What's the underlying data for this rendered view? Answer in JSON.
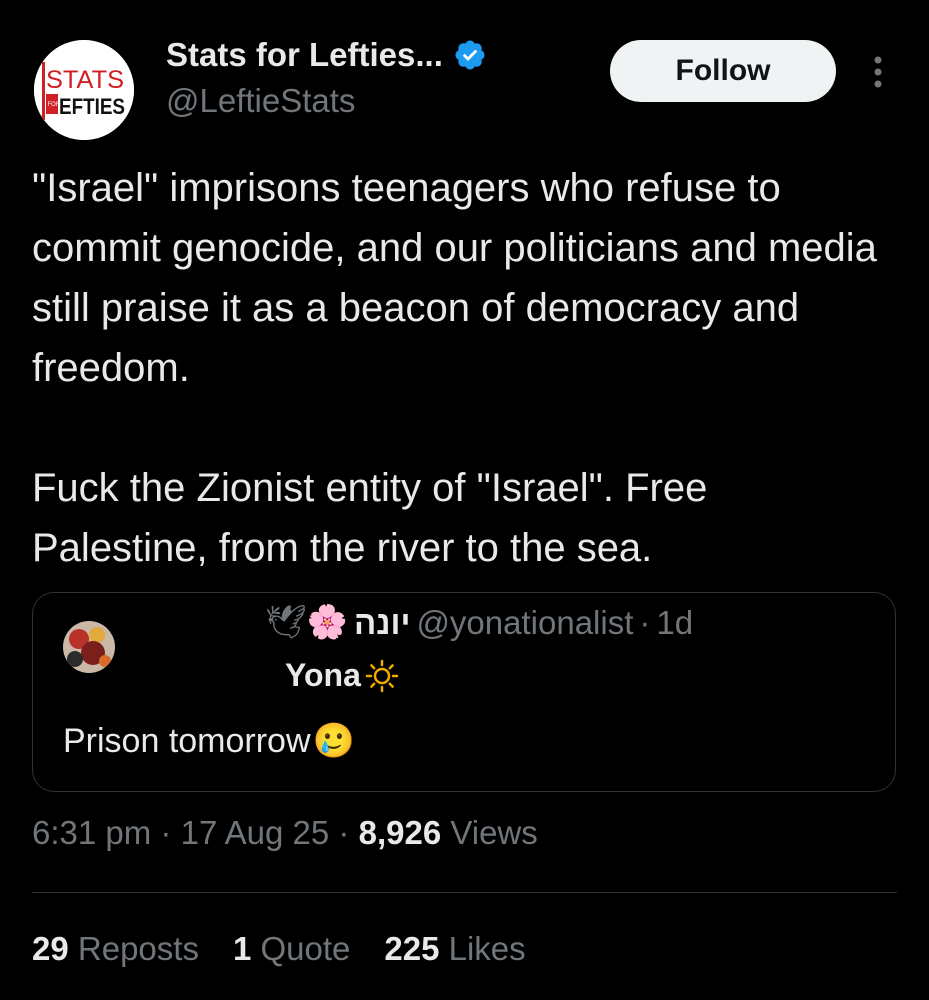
{
  "author": {
    "display_name": "Stats for Lefties...",
    "handle": "@LeftieStats",
    "verified": true,
    "avatar_logo": {
      "line1": "STATS",
      "badge": "FOR",
      "line2": "LEFTIES"
    }
  },
  "follow_button": {
    "label": "Follow"
  },
  "more_button": {
    "icon": "more-vertical-icon"
  },
  "tweet": {
    "paragraphs": [
      "\"Israel\" imprisons teenagers who refuse to commit genocide, and our politicians and media still praise it as a beacon of democracy and freedom.",
      "Fuck the Zionist entity of \"Israel\". Free Palestine, from the river to the sea."
    ]
  },
  "quote": {
    "name_emojis": "🕊🌸",
    "name_hebrew": "יונה",
    "handle": "@yonationalist",
    "separator": "·",
    "age": "1d",
    "display_name": "Yona",
    "display_name_icon": "sun-icon",
    "text": "Prison tomorrow",
    "text_emoji": "🥲"
  },
  "meta": {
    "time": "6:31 pm",
    "sep1": "·",
    "date": "17 Aug 25",
    "sep2": "·",
    "views_count": "8,926",
    "views_label": "Views"
  },
  "stats": [
    {
      "count": "29",
      "label": "Reposts"
    },
    {
      "count": "1",
      "label": "Quote"
    },
    {
      "count": "225",
      "label": "Likes"
    }
  ],
  "colors": {
    "background": "#000000",
    "text": "#e7e9ea",
    "muted": "#71767b",
    "border": "#2f3336",
    "verified": "#1d9bf0",
    "logo_red": "#d11f26"
  }
}
